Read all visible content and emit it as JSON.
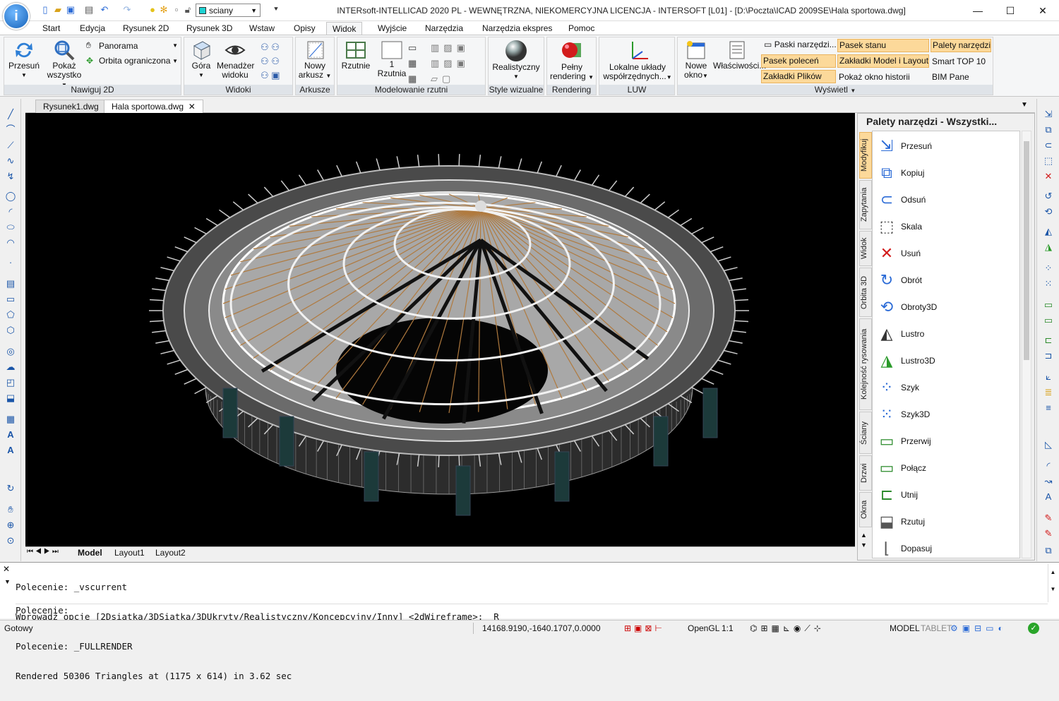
{
  "titlebar": {
    "title": "INTERsoft-INTELLICAD 2020 PL - WEWNĘTRZNA, NIEKOMERCYJNA LICENCJA - INTERSOFT [L01] - [D:\\Poczta\\ICAD 2009SE\\Hala sportowa.dwg]",
    "layer": "sciany",
    "minimize": "—",
    "maximize": "☐",
    "close": "✕"
  },
  "menu_tabs": [
    "Start",
    "Edycja",
    "Rysunek 2D",
    "Rysunek 3D",
    "Wstaw",
    "Opisy",
    "Widok",
    "Wyjście",
    "Narzędzia",
    "Narzędzia ekspres",
    "Pomoc"
  ],
  "active_tab": "Widok",
  "ribbon": {
    "nav2d": {
      "label": "Nawiguj 2D",
      "przesun": "Przesuń",
      "pokaz1": "Pokaż",
      "pokaz2": "wszystko",
      "panorama": "Panorama",
      "orbita": "Orbita ograniczona"
    },
    "widoki": {
      "label": "Widoki",
      "gora": "Góra",
      "manager1": "Menadżer",
      "manager2": "widoku"
    },
    "arkusze": {
      "label": "Arkusze",
      "nowy1": "Nowy",
      "nowy2": "arkusz"
    },
    "rzutnie": {
      "label": "Modelowanie rzutni",
      "rzutnie": "Rzutnie",
      "count": "1",
      "rzutnia": "Rzutnia"
    },
    "style": {
      "label": "Style wizualne",
      "real": "Realistyczny"
    },
    "render": {
      "label": "Rendering",
      "pelny1": "Pełny",
      "pelny2": "rendering"
    },
    "luw": {
      "label": "LUW",
      "lok1": "Lokalne układy",
      "lok2": "współrzędnych..."
    },
    "wyswietl": {
      "label": "Wyświetl",
      "nowe1": "Nowe",
      "nowe2": "okno",
      "wlasc": "Właściwości...",
      "paski": "Paski narzędzi...",
      "pasek_polecen": "Pasek poleceń",
      "zakladki_plikow": "Zakładki Plików",
      "pasek_stanu": "Pasek stanu",
      "zakladki_model": "Zakładki Model i Layout",
      "pokaz_historii": "Pokaż okno historii",
      "palety": "Palety narzędzi",
      "smart": "Smart TOP 10",
      "bim": "BIM Pane"
    }
  },
  "doc_tabs": [
    {
      "name": "Rysunek1.dwg"
    },
    {
      "name": "Hala sportowa.dwg",
      "close": "✕"
    }
  ],
  "layout_tabs": [
    "Model",
    "Layout1",
    "Layout2"
  ],
  "palette": {
    "title": "Palety narzędzi - Wszystki...",
    "vtabs": [
      "Modyfikuj",
      "Zapytania",
      "Widok",
      "Orbita 3D",
      "Kolejność rysowania",
      "Ściany",
      "Drzwi",
      "Okna"
    ],
    "tools": [
      "Przesuń",
      "Kopiuj",
      "Odsuń",
      "Skala",
      "Usuń",
      "Obrót",
      "Obroty3D",
      "Lustro",
      "Lustro3D",
      "Szyk",
      "Szyk3D",
      "Przerwij",
      "Połącz",
      "Utnij",
      "Rzutuj",
      "Dopasuj"
    ]
  },
  "command": {
    "lines": [
      "Polecenie: _vscurrent",
      "Wprowadź opcje [2Dsiatka/3DSiatka/3DUkryty/Realistyczny/Koncepcyjny/Inny] <2dWireframe>: _R",
      "Polecenie: _FULLRENDER",
      "Rendered 50306 Triangles at (1175 x 614) in 3.62 sec"
    ],
    "prompt": "Polecenie:"
  },
  "status": {
    "ready": "Gotowy",
    "coords": "14168.9190,-1640.1707,0.0000",
    "opengl": "OpenGL",
    "scale": "1:1",
    "model": "MODEL",
    "tablet": "TABLET"
  }
}
